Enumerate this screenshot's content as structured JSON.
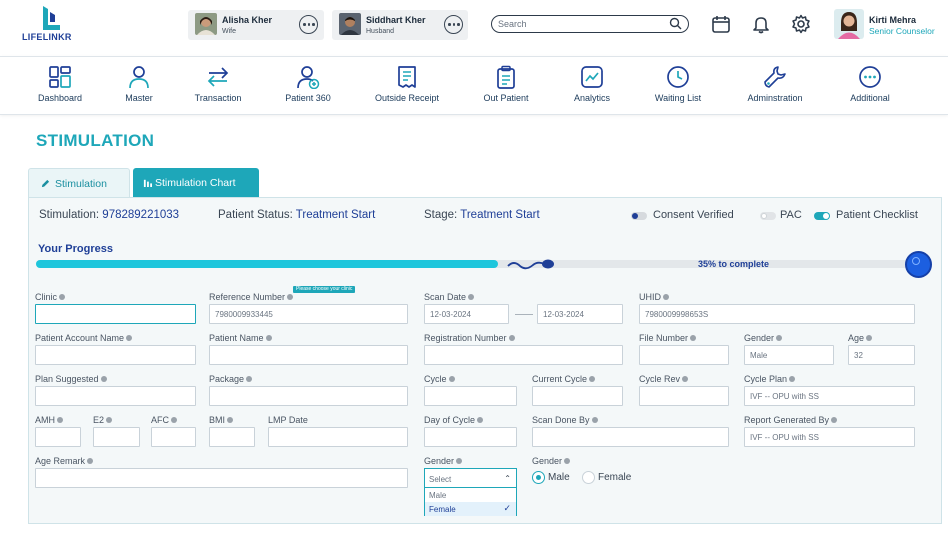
{
  "brand": {
    "name": "LIFELINKR"
  },
  "header": {
    "persons": [
      {
        "name": "Alisha Kher",
        "role": "Wife"
      },
      {
        "name": "Siddhart Kher",
        "role": "Husband"
      }
    ],
    "search": {
      "placeholder": "Search",
      "value": ""
    },
    "icons": [
      "calendar-icon",
      "bell-icon",
      "gear-icon"
    ],
    "user": {
      "name": "Kirti Mehra",
      "role": "Senior Counselor"
    }
  },
  "nav": {
    "items": [
      {
        "label": "Dashboard",
        "icon": "dashboard-icon"
      },
      {
        "label": "Master",
        "icon": "user-icon"
      },
      {
        "label": "Transaction",
        "icon": "swap-icon"
      },
      {
        "label": "Patient 360",
        "icon": "add-user-icon"
      },
      {
        "label": "Outside Receipt",
        "icon": "receipt-icon"
      },
      {
        "label": "Out Patient",
        "icon": "clipboard-icon"
      },
      {
        "label": "Analytics",
        "icon": "analytics-icon"
      },
      {
        "label": "Waiting List",
        "icon": "clock-icon"
      },
      {
        "label": "Adminstration",
        "icon": "wrench-icon"
      },
      {
        "label": "Additional",
        "icon": "more-icon"
      }
    ]
  },
  "page": {
    "title": "STIMULATION",
    "tabs": [
      {
        "label": "Stimulation",
        "icon": "pencil-icon",
        "active": true
      },
      {
        "label": "Stimulation Chart",
        "icon": "bar-chart-icon",
        "active": false
      }
    ],
    "info": {
      "stimulation_label": "Stimulation:",
      "stimulation_value": "978289221033",
      "status_label": "Patient Status:",
      "status_value": "Treatment Start",
      "stage_label": "Stage:",
      "stage_value": "Treatment Start"
    },
    "toggles": [
      {
        "label": "Consent Verified",
        "on": true
      },
      {
        "label": "PAC",
        "on": false
      },
      {
        "label": "Patient Checklist",
        "on": true
      }
    ],
    "progress": {
      "title": "Your Progress",
      "percent": 35,
      "text": "35% to complete"
    }
  },
  "form": {
    "clinic": {
      "label": "Clinic",
      "value": ""
    },
    "reference_number": {
      "label": "Reference Number",
      "value": "7980009933445",
      "tooltip": "Please choose your clinic"
    },
    "scan_date": {
      "label": "Scan Date",
      "from": "12-03-2024",
      "to": "12-03-2024"
    },
    "uhid": {
      "label": "UHID",
      "value": "7980009998653S"
    },
    "patient_account_name": {
      "label": "Patient Account Name",
      "value": ""
    },
    "patient_name": {
      "label": "Patient Name",
      "value": ""
    },
    "registration_number": {
      "label": "Registration Number",
      "value": ""
    },
    "file_number": {
      "label": "File Number",
      "value": ""
    },
    "gender_top": {
      "label": "Gender",
      "value": "Male"
    },
    "age": {
      "label": "Age",
      "value": "32"
    },
    "plan_suggested": {
      "label": "Plan Suggested",
      "value": ""
    },
    "package": {
      "label": "Package",
      "value": ""
    },
    "cycle": {
      "label": "Cycle",
      "value": ""
    },
    "current_cycle": {
      "label": "Current Cycle",
      "value": ""
    },
    "cycle_rev": {
      "label": "Cycle Rev",
      "value": ""
    },
    "cycle_plan": {
      "label": "Cycle Plan",
      "value": "IVF -- OPU with SS"
    },
    "amh": {
      "label": "AMH",
      "value": ""
    },
    "e2": {
      "label": "E2",
      "value": ""
    },
    "afc": {
      "label": "AFC",
      "value": ""
    },
    "bmi": {
      "label": "BMI",
      "value": ""
    },
    "lmp_date": {
      "label": "LMP Date",
      "value": ""
    },
    "day_of_cycle": {
      "label": "Day of Cycle",
      "value": ""
    },
    "scan_done_by": {
      "label": "Scan Done By",
      "value": ""
    },
    "report_generated_by": {
      "label": "Report Generated By",
      "value": "IVF -- OPU with SS"
    },
    "age_remark": {
      "label": "Age Remark",
      "value": ""
    },
    "gender_select": {
      "label": "Gender",
      "placeholder": "Select",
      "options": [
        "Male",
        "Female"
      ],
      "selected": "Female"
    },
    "gender_radio": {
      "label": "Gender",
      "options": [
        "Male",
        "Female"
      ],
      "selected": "Male"
    }
  }
}
